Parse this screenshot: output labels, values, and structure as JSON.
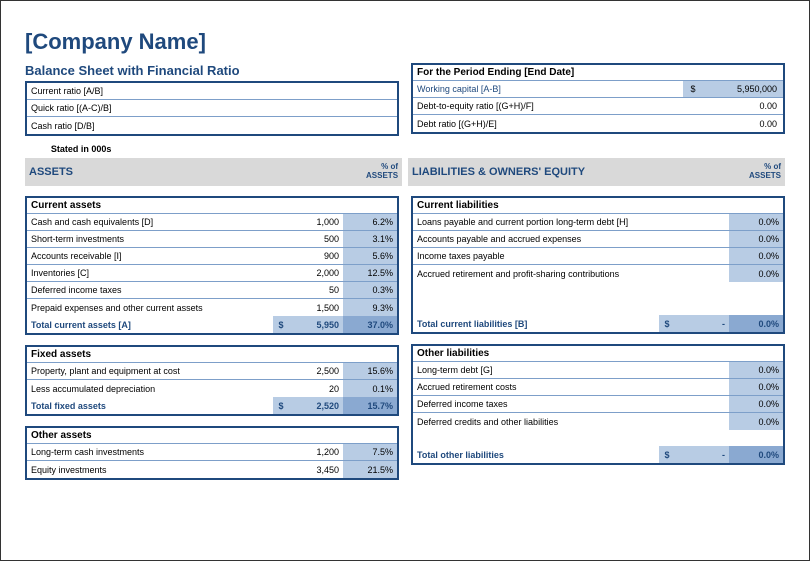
{
  "title": "[Company Name]",
  "subtitle": "Balance Sheet with Financial Ratio",
  "period_title": "For the Period Ending [End Date]",
  "stated": "Stated in 000s",
  "ratios": [
    {
      "label": "Current ratio [A/B]",
      "val": ""
    },
    {
      "label": "Quick ratio [(A-C)/B]",
      "val": ""
    },
    {
      "label": "Cash ratio [D/B]",
      "val": ""
    }
  ],
  "working": [
    {
      "label": "Working capital [A-B]",
      "sym": "$",
      "val": "5,950,000"
    },
    {
      "label": "Debt-to-equity ratio [(G+H)/F]",
      "sym": "",
      "val": "0.00"
    },
    {
      "label": "Debt ratio [(G+H)/E]",
      "sym": "",
      "val": "0.00"
    }
  ],
  "assets_header": "ASSETS",
  "pct_assets": "% of ASSETS",
  "liab_header": "LIABILITIES & OWNERS' EQUITY",
  "current_assets": {
    "title": "Current assets",
    "rows": [
      {
        "label": "Cash and cash equivalents [D]",
        "val": "1,000",
        "pct": "6.2%"
      },
      {
        "label": "Short-term investments",
        "val": "500",
        "pct": "3.1%"
      },
      {
        "label": "Accounts receivable [I]",
        "val": "900",
        "pct": "5.6%"
      },
      {
        "label": "Inventories [C]",
        "val": "2,000",
        "pct": "12.5%"
      },
      {
        "label": "Deferred income taxes",
        "val": "50",
        "pct": "0.3%"
      },
      {
        "label": "Prepaid expenses and other current assets",
        "val": "1,500",
        "pct": "9.3%"
      }
    ],
    "total": {
      "label": "Total current assets [A]",
      "sym": "$",
      "val": "5,950",
      "pct": "37.0%"
    }
  },
  "fixed_assets": {
    "title": "Fixed assets",
    "rows": [
      {
        "label": "Property, plant and equipment at cost",
        "val": "2,500",
        "pct": "15.6%"
      },
      {
        "label": "Less accumulated depreciation",
        "val": "20",
        "pct": "0.1%"
      }
    ],
    "total": {
      "label": "Total fixed assets",
      "sym": "$",
      "val": "2,520",
      "pct": "15.7%"
    }
  },
  "other_assets": {
    "title": "Other assets",
    "rows": [
      {
        "label": "Long-term cash investments",
        "val": "1,200",
        "pct": "7.5%"
      },
      {
        "label": "Equity investments",
        "val": "3,450",
        "pct": "21.5%"
      }
    ]
  },
  "current_liabilities": {
    "title": "Current liabilities",
    "rows": [
      {
        "label": "Loans payable and current portion long-term debt [H]",
        "val": "",
        "pct": "0.0%"
      },
      {
        "label": "Accounts payable and accrued expenses",
        "val": "",
        "pct": "0.0%"
      },
      {
        "label": "Income taxes payable",
        "val": "",
        "pct": "0.0%"
      },
      {
        "label": "Accrued retirement and profit-sharing contributions",
        "val": "",
        "pct": "0.0%"
      }
    ],
    "total": {
      "label": "Total current liabilities [B]",
      "sym": "$",
      "val": "-",
      "pct": "0.0%"
    }
  },
  "other_liabilities": {
    "title": "Other liabilities",
    "rows": [
      {
        "label": "Long-term debt [G]",
        "val": "",
        "pct": "0.0%"
      },
      {
        "label": "Accrued retirement costs",
        "val": "",
        "pct": "0.0%"
      },
      {
        "label": "Deferred income taxes",
        "val": "",
        "pct": "0.0%"
      },
      {
        "label": "Deferred credits and other liabilities",
        "val": "",
        "pct": "0.0%"
      }
    ],
    "total": {
      "label": "Total other liabilities",
      "sym": "$",
      "val": "-",
      "pct": "0.0%"
    }
  }
}
